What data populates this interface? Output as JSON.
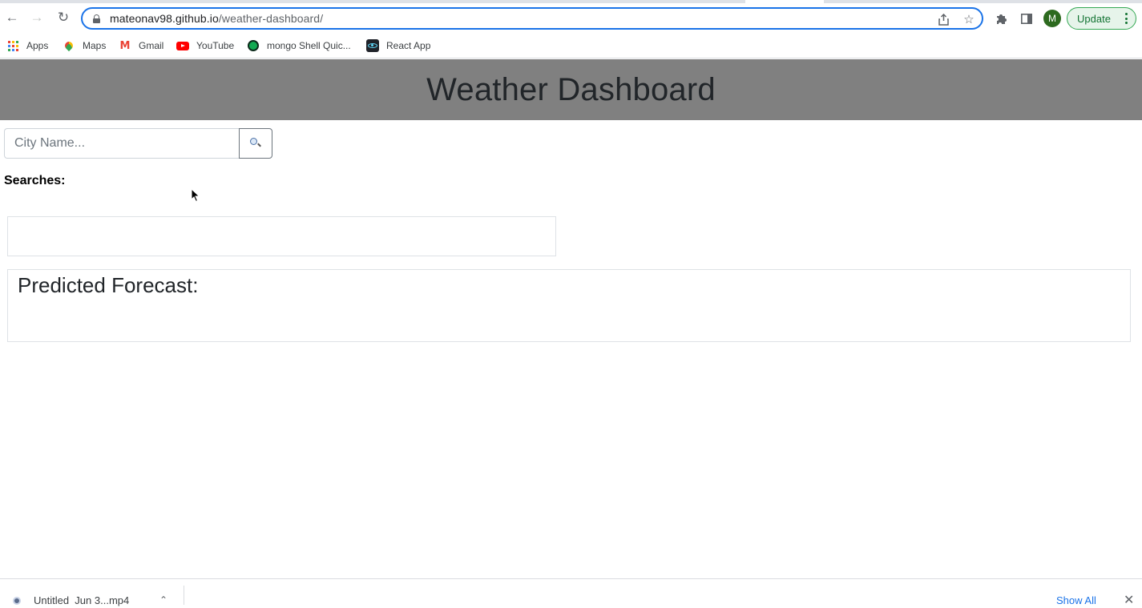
{
  "browser": {
    "url_host": "mateonav98.github.io",
    "url_path": "/weather-dashboard/",
    "profile_initial": "M",
    "update_label": "Update",
    "icons": {
      "back": "arrow-left-icon",
      "forward": "arrow-right-icon",
      "reload": "reload-icon",
      "lock": "lock-icon",
      "share": "share-icon",
      "bookmark": "star-icon",
      "extensions": "puzzle-icon",
      "side_panel": "side-panel-icon",
      "menu": "kebab-menu-icon"
    },
    "colors": {
      "focus_ring": "#1a73e8",
      "update_green": "#137333",
      "avatar": "#2d6a1f"
    }
  },
  "bookmarks": [
    {
      "label": "Apps",
      "icon": "apps-grid-icon"
    },
    {
      "label": "Maps",
      "icon": "maps-icon"
    },
    {
      "label": "Gmail",
      "icon": "gmail-icon"
    },
    {
      "label": "YouTube",
      "icon": "youtube-icon"
    },
    {
      "label": "mongo Shell Quic...",
      "icon": "mongodb-icon"
    },
    {
      "label": "React App",
      "icon": "react-icon"
    }
  ],
  "page": {
    "title": "Weather Dashboard",
    "search": {
      "placeholder": "City Name...",
      "value": "",
      "button_icon": "magnifier-icon"
    },
    "searches_label": "Searches:",
    "forecast_title": "Predicted Forecast:",
    "colors": {
      "header_bg": "#808080",
      "text": "#212529"
    }
  },
  "downloads": {
    "file_label": "Untitled  Jun 3...mp4",
    "show_all_label": "Show All"
  }
}
